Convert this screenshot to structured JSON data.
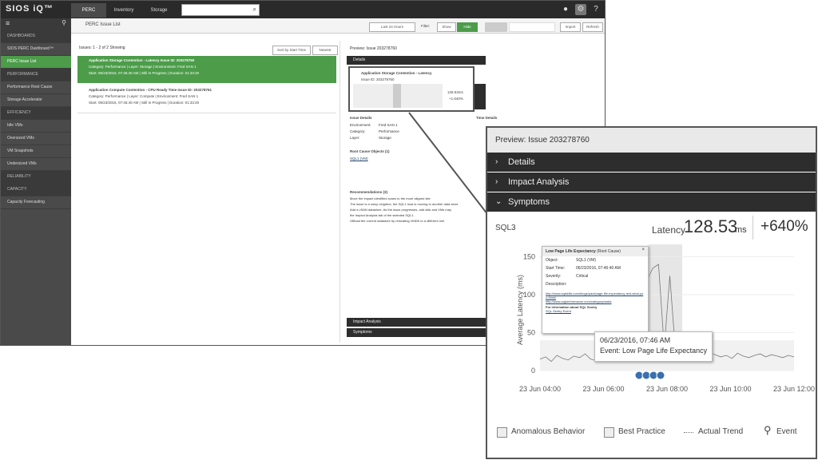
{
  "app": {
    "logo": "SIOS iQ™",
    "nav_tabs": [
      "PERC",
      "Inventory",
      "Storage"
    ],
    "search_placeholder": "",
    "icons": [
      "user-icon",
      "gear-icon",
      "help-icon"
    ]
  },
  "sidebar": {
    "items": [
      {
        "label": "DASHBOARDS",
        "type": "section"
      },
      {
        "label": "SIOS PERC Dashboard™",
        "type": "item"
      },
      {
        "label": "PERC Issue List",
        "type": "active"
      },
      {
        "label": "PERFORMANCE",
        "type": "section"
      },
      {
        "label": "Performance Root Cause",
        "type": "item"
      },
      {
        "label": "Storage Accelerator",
        "type": "item"
      },
      {
        "label": "EFFICIENCY",
        "type": "section"
      },
      {
        "label": "Idle VMs",
        "type": "item"
      },
      {
        "label": "Oversized VMs",
        "type": "item"
      },
      {
        "label": "VM Snapshots",
        "type": "item"
      },
      {
        "label": "Undersized VMs",
        "type": "item"
      },
      {
        "label": "RELIABILITY",
        "type": "section"
      },
      {
        "label": "CAPACITY",
        "type": "section"
      },
      {
        "label": "Capacity Forecasting",
        "type": "item"
      }
    ]
  },
  "breadcrumb": {
    "title": "PERC Issue List"
  },
  "controls": {
    "range": "Last 24 Hours",
    "filter_label": "Filter:",
    "show": "Show",
    "hide": "Hide",
    "disabled_1": "",
    "disabled_2": "",
    "import": "Import",
    "refresh": "Refresh"
  },
  "issues": {
    "header": "Issues: 1 - 2 of 2 Showing",
    "sort": "Sort by Start Time",
    "order": "Newest",
    "cards": [
      {
        "title": "Application Storage Contention - Latency Issue ID: 203278760",
        "line2": "Category: Performance  |  Layer: Storage  |  Environment: Fred SAN 1",
        "line3": "Start: 06/23/2016, 07:46:40 AM  |  Still In Progress  |  Duration: 01:33:20"
      },
      {
        "title": "Application Compute Contention - CPU Ready Time  Issue ID: 203278761",
        "line2": "Category: Performance  |  Layer: Compute  |  Environment: Fred SAN 1",
        "line3": "Start: 06/23/2016, 07:46:40 AM  |  Still In Progress  |  Duration: 01:33:20"
      }
    ]
  },
  "preview": {
    "header": "Preview: Issue 203278760",
    "details": "Details",
    "mini_title": "Application Storage Contention - Latency",
    "mini_sub": "Issue ID: 203278760",
    "mini_value": "128.53ms",
    "mini_change": "+1.640%",
    "issue_details": "Issue Details",
    "kv": [
      {
        "k": "Environment:",
        "v": "Fred SAN 1"
      },
      {
        "k": "Category:",
        "v": "Performance"
      },
      {
        "k": "Layer:",
        "v": "Storage"
      }
    ],
    "time_details": "Time Details",
    "root_cause": "Root Cause Objects (1)",
    "root_cause_item": "SQL1 (VM)",
    "recommendations": "Recommendations (3)",
    "rec_lines": [
      "Move the impact identified scans to the more aligned site",
      "The issue is a noisy neighbor, the SQL1 host is moving to another data store",
      "Add a vSAN datastore. As the issue progresses, add disk and VMs may",
      "the Impact Analysis tab of the selected SQL1.",
      "Offload the current datastore by relocating VMDK to a different one"
    ],
    "impact": "Impact Analysis",
    "symptoms": "Symptoms"
  },
  "inset": {
    "header": "Preview: Issue 203278760",
    "bars": [
      "Details",
      "Impact Analysis",
      "Symptoms"
    ],
    "object": "SQL3",
    "latency_label": "Latency",
    "latency_value": "128.53",
    "latency_unit": "ms",
    "change": "+640%",
    "tooltip": {
      "title": "Low Page Life Expectancy",
      "tag": "(Root Cause)",
      "rows": [
        {
          "k": "Object:",
          "v": "SQL1 (VM)"
        },
        {
          "k": "Start Time:",
          "v": "06/23/2016, 07:46:40 AM"
        },
        {
          "k": "Severity:",
          "v": "Critical"
        },
        {
          "k": "Description:",
          "v": ""
        }
      ],
      "links": [
        "http://www.sqlskills.com/blogs/paul/page-life-expectancy-isnt-what-you-think/",
        "http://www.sqlperformance.com/category/waits"
      ],
      "more": "For information about SQL Sentry",
      "more_link": "SQL Sentry Event"
    },
    "event_box": {
      "date": "06/23/2016, 07:46 AM",
      "event": "Event: Low Page Life Expectancy"
    },
    "legend": [
      "Anomalous Behavior",
      "Best Practice",
      "Actual Trend",
      "Event"
    ]
  },
  "chart_data": {
    "type": "line",
    "ylabel": "Average Latency (ms)",
    "yticks": [
      0,
      50,
      100,
      150
    ],
    "xticks": [
      "23 Jun 04:00",
      "23 Jun 06:00",
      "23 Jun 08:00",
      "23 Jun 10:00",
      "23 Jun 12:00"
    ],
    "ylim": [
      0,
      160
    ],
    "series": [
      {
        "values": [
          15,
          18,
          12,
          20,
          16,
          14,
          19,
          17,
          22,
          15,
          13,
          18,
          21,
          16,
          14,
          19,
          24,
          18,
          15,
          120,
          135,
          140,
          30,
          125,
          25,
          20,
          18,
          22,
          17,
          19,
          24,
          21,
          18,
          20,
          16,
          23,
          19,
          17,
          20,
          22,
          18,
          21,
          19,
          17,
          20,
          18
        ]
      }
    ],
    "events": 4
  }
}
